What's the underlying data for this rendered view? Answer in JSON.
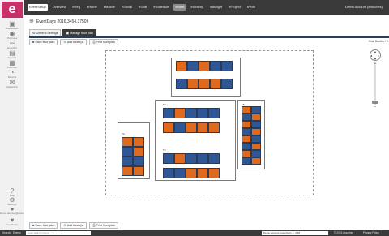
{
  "rail": {
    "logo": "e",
    "items": [
      {
        "label": "Dashboard",
        "icon": "dashboard-icon"
      },
      {
        "label": "Overview",
        "icon": "eye-icon"
      },
      {
        "label": "Eventlist",
        "icon": "list-icon"
      },
      {
        "label": "Agenda",
        "icon": "agenda-icon"
      },
      {
        "label": "Calendar",
        "icon": "calendar-icon"
      },
      {
        "label": "Reports",
        "icon": "reports-icon"
      },
      {
        "label": "Marketing",
        "icon": "marketing-icon"
      }
    ],
    "bottom": [
      {
        "label": "Help",
        "icon": "help-icon"
      },
      {
        "label": "Settings",
        "icon": "gear-icon"
      },
      {
        "label": "Demo.dev dev@etouches.com",
        "icon": "user-icon"
      },
      {
        "label": "Feedback",
        "icon": "chat-icon"
      }
    ]
  },
  "topbar": {
    "nav": [
      "EventSetup",
      "Overview",
      "eReg",
      "eHome",
      "eMobile",
      "eSocial",
      "eSeat",
      "eSchedule",
      "eMeet",
      "eSeating",
      "eBudget",
      "eProject",
      "eVote"
    ],
    "active_index": 0,
    "current_index": 8,
    "account": "Demo Account (etouches)"
  },
  "event": {
    "icon": "plus-circle-icon",
    "title": "EventDays 2016.3454.37506"
  },
  "subtabs": [
    {
      "label": "General Settings",
      "active": false,
      "icon": "gear-icon"
    },
    {
      "label": "Manage floor plan",
      "active": true,
      "icon": "floorplan-icon"
    }
  ],
  "toolbar": {
    "save": "Save floor plan",
    "add": "Add booth(s)",
    "print": "Print floor plan"
  },
  "grid_label": "Hide Booths / X",
  "colors": {
    "booth_blue": "#2f5794",
    "booth_orange": "#dd6a1f",
    "logo": "#c8306a",
    "topbar": "#3a3a3a"
  },
  "tables": {
    "top_row1": [
      "o",
      "b",
      "o",
      "b",
      "b"
    ],
    "top_row2": [
      "b",
      "o",
      "o",
      "o",
      "b"
    ],
    "mid_row1": [
      "b",
      "o",
      "b",
      "b",
      "b"
    ],
    "mid_row2": [
      "o",
      "b",
      "o",
      "o",
      "o"
    ],
    "low_row1": [
      "b",
      "o",
      "b",
      "b",
      "b"
    ],
    "low_row2": [
      "b",
      "b",
      "o",
      "o",
      "o"
    ],
    "left_col1": [
      "o",
      "b",
      "b",
      "o"
    ],
    "left_col2": [
      "o",
      "o",
      "b",
      "o"
    ],
    "right_col1": [
      "o",
      "b",
      "o",
      "b",
      "o",
      "b",
      "o",
      "b"
    ],
    "right_col2": [
      "b",
      "o",
      "b",
      "o",
      "b",
      "o",
      "b",
      "o"
    ],
    "labels": {
      "top": "Table A1",
      "top_sub": "T-1",
      "mid": "T2",
      "low": "T3",
      "left": "T4",
      "right": "T5"
    }
  },
  "footer": {
    "left1": "Search",
    "left2": "Events",
    "search_placeholder": "enter search criteria",
    "select_value": "Demo Account (etouches) — 3.68",
    "right1": "© 2016 etouches",
    "right2": "Privacy Policy"
  }
}
